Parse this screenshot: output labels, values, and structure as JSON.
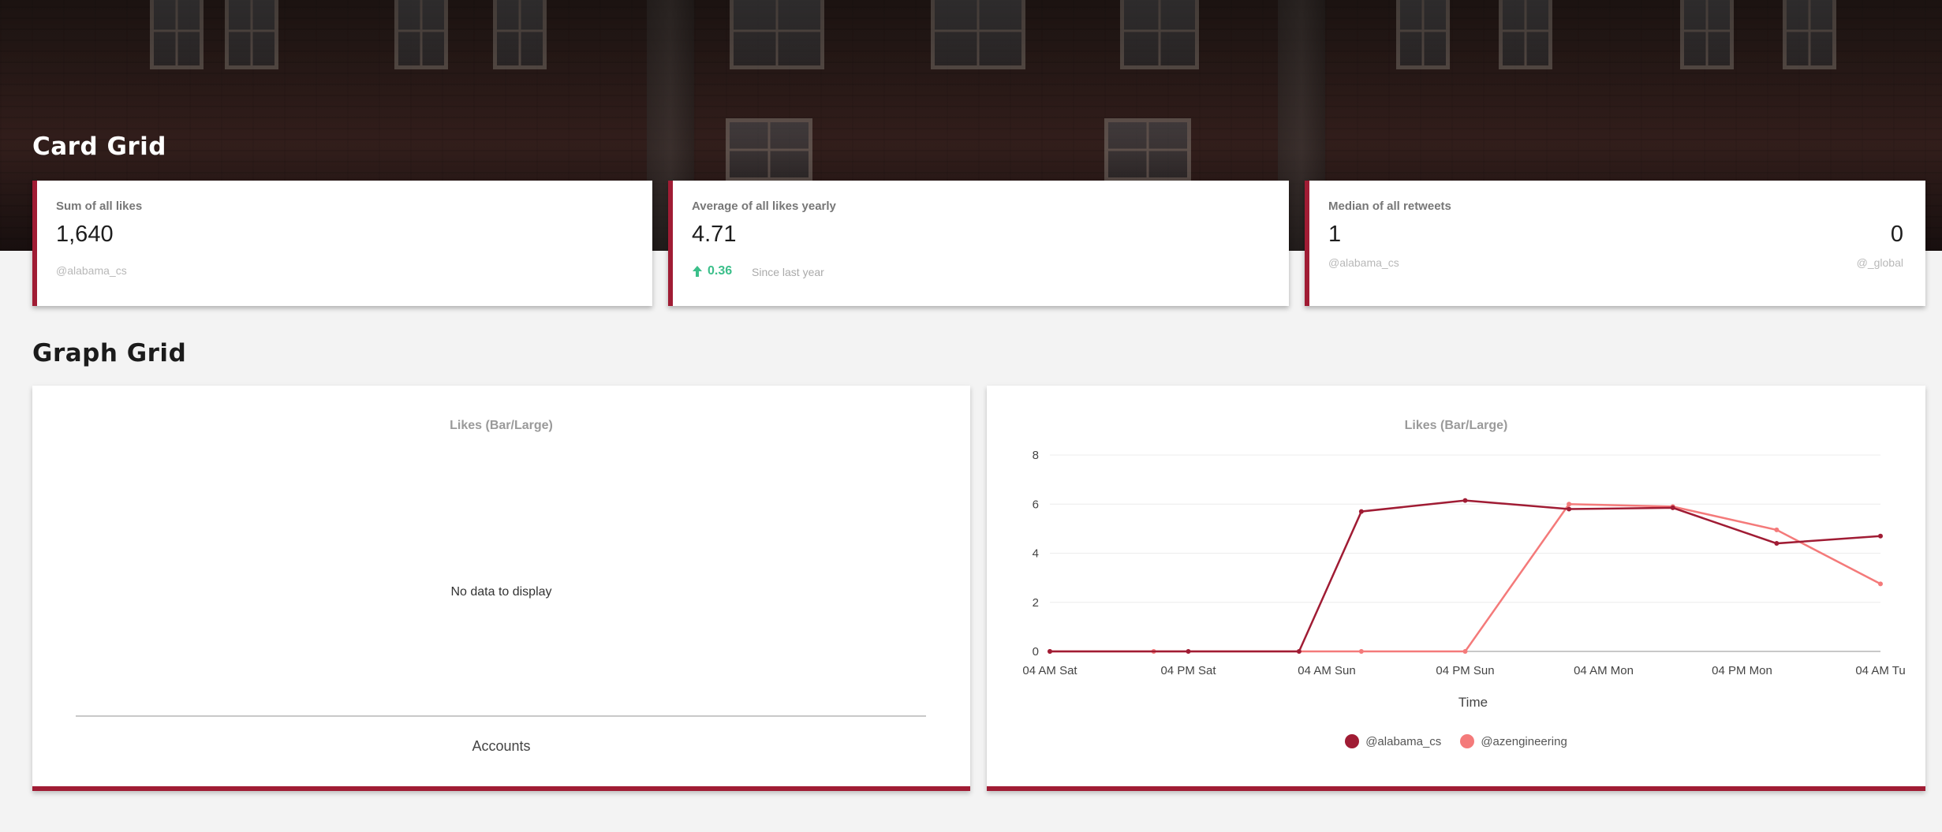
{
  "sections": {
    "card_grid_title": "Card Grid",
    "graph_grid_title": "Graph Grid"
  },
  "cards": [
    {
      "label": "Sum of all likes",
      "value": "1,640",
      "handle": "@alabama_cs"
    },
    {
      "label": "Average of all likes yearly",
      "value": "4.71",
      "change": "0.36",
      "change_direction": "up",
      "since": "Since last year"
    },
    {
      "label": "Median of all retweets",
      "value": "1",
      "handle": "@alabama_cs",
      "value_right": "0",
      "handle_right": "@_global"
    }
  ],
  "graphs": [
    {
      "title": "Likes (Bar/Large)",
      "empty_message": "No data to display",
      "xlabel": "Accounts"
    },
    {
      "title": "Likes (Bar/Large)",
      "xlabel": "Time"
    }
  ],
  "colors": {
    "accent": "#a01c34",
    "series_1": "#a01c34",
    "series_2": "#f47a7a",
    "positive": "#3bbf8a"
  },
  "chart_data": {
    "type": "line",
    "title": "Likes (Bar/Large)",
    "xlabel": "Time",
    "ylabel": "",
    "ylim": [
      0,
      8
    ],
    "yticks": [
      0,
      2,
      4,
      6,
      8
    ],
    "x_ticks": [
      "04 AM Sat",
      "04 PM Sat",
      "04 AM Sun",
      "04 PM Sun",
      "04 AM Mon",
      "04 PM Mon",
      "04 AM Tu"
    ],
    "grid": true,
    "legend_position": "bottom",
    "series": [
      {
        "name": "@alabama_cs",
        "color": "#a01c34",
        "x": [
          0,
          1,
          1.8,
          2.25,
          3,
          3.75,
          4.5,
          5.25,
          6
        ],
        "values": [
          0,
          0,
          0,
          5.7,
          6.15,
          5.8,
          5.85,
          4.4,
          4.7
        ]
      },
      {
        "name": "@azengineering",
        "color": "#f47a7a",
        "x": [
          0,
          0.75,
          2.25,
          3,
          3.75,
          4.5,
          5.25,
          6
        ],
        "values": [
          0,
          0,
          0,
          0,
          6.0,
          5.9,
          4.95,
          2.75
        ]
      }
    ]
  }
}
